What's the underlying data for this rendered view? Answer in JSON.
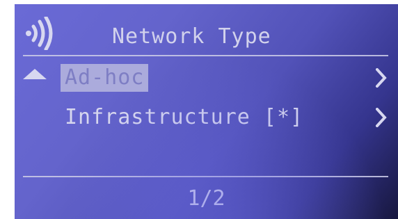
{
  "header": {
    "title": "Network Type",
    "icon": "wireless-signal-icon"
  },
  "menu": {
    "items": [
      {
        "label": "Ad-hoc",
        "selected": true,
        "icon": "chevron-right-icon"
      },
      {
        "label": "Infrastructure [*]",
        "selected": false,
        "icon": "chevron-right-icon"
      }
    ],
    "scroll_icon": "triangle-up-icon"
  },
  "footer": {
    "page": "1/2"
  },
  "colors": {
    "background_light": "#6a6ad6",
    "background_dark": "#17173e",
    "text": "#d6d6ee",
    "highlight_bg": "#ababdc",
    "highlight_text": "#7e7ec4"
  }
}
